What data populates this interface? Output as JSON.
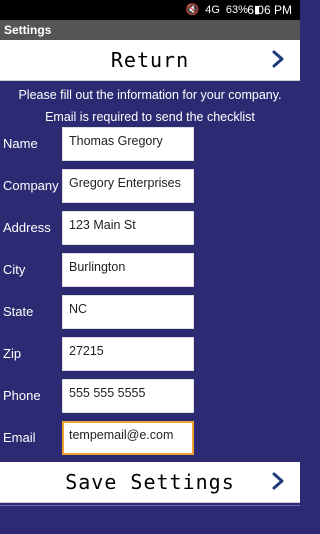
{
  "status_bar": {
    "battery": "63%",
    "time": "6:06 PM",
    "signal": "4G"
  },
  "title_bar": {
    "title": "Settings"
  },
  "return_button": {
    "label": "Return"
  },
  "instructions": {
    "line1": "Please fill out the information for your company.",
    "line2": "Email is required to send the checklist"
  },
  "form": {
    "fields": [
      {
        "label": "Name",
        "value": "Thomas Gregory"
      },
      {
        "label": "Company",
        "value": "Gregory Enterprises"
      },
      {
        "label": "Address",
        "value": "123 Main St"
      },
      {
        "label": "City",
        "value": "Burlington"
      },
      {
        "label": "State",
        "value": "NC"
      },
      {
        "label": "Zip",
        "value": "27215"
      },
      {
        "label": "Phone",
        "value": "555 555 5555"
      },
      {
        "label": "Email",
        "value": "tempemail@e.com"
      }
    ]
  },
  "save_button": {
    "label": "Save Settings"
  },
  "colors": {
    "background": "#2b2a73",
    "focus_border": "#f0a030",
    "chevron": "#1f3a7a"
  }
}
